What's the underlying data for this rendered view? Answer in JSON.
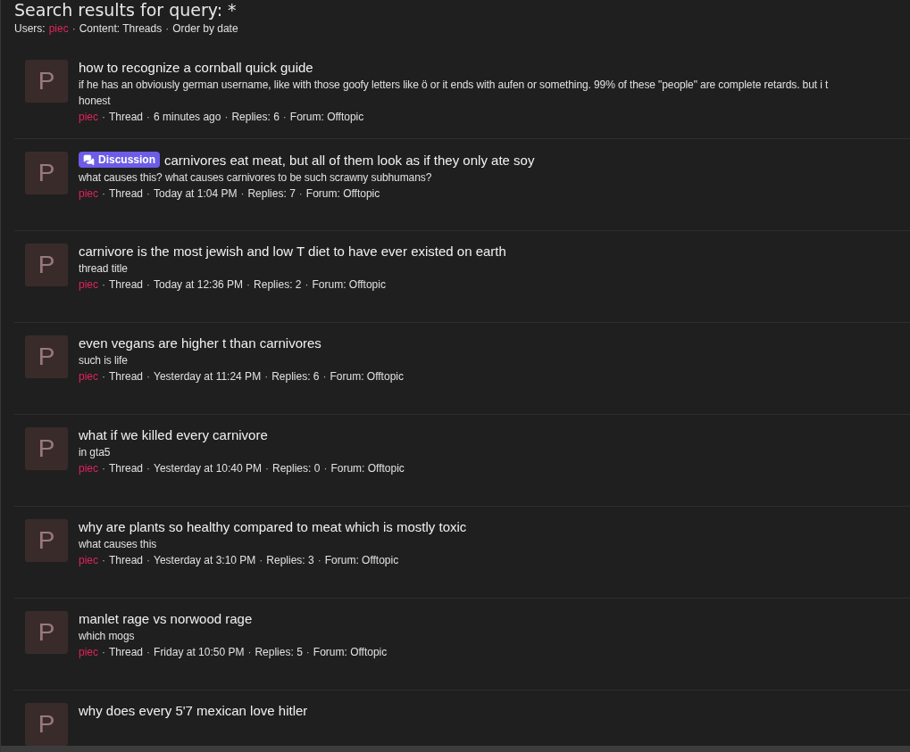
{
  "separator": "·",
  "header": {
    "title": "Search results for query: *",
    "filters": [
      {
        "label": "Users:",
        "value": "piec",
        "kind": "user"
      },
      {
        "label": "Content: Threads",
        "kind": "text"
      },
      {
        "label": "Order by date",
        "kind": "text"
      }
    ]
  },
  "results": [
    {
      "avatar": "P",
      "title": "how to recognize a cornball quick guide",
      "snippet_lines": [
        "if he has an obviously german username, like with those goofy letters like ö or it ends with aufen or something. 99% of these \"people\" are complete retards. but i t",
        "honest"
      ],
      "author": "piec",
      "meta": [
        "Thread",
        "6 minutes ago",
        "Replies: 6",
        "Forum: Offtopic"
      ]
    },
    {
      "avatar": "P",
      "prefix": {
        "label": "Discussion",
        "color": "#6c5ce7"
      },
      "title": "carnivores eat meat, but all of them look as if they only ate soy",
      "snippet_lines": [
        "what causes this? what causes carnivores to be such scrawny subhumans?"
      ],
      "author": "piec",
      "meta": [
        "Thread",
        "Today at 1:04 PM",
        "Replies: 7",
        "Forum: Offtopic"
      ]
    },
    {
      "avatar": "P",
      "title": "carnivore is the most jewish and low T diet to have ever existed on earth",
      "snippet_lines": [
        "thread title"
      ],
      "author": "piec",
      "meta": [
        "Thread",
        "Today at 12:36 PM",
        "Replies: 2",
        "Forum: Offtopic"
      ]
    },
    {
      "avatar": "P",
      "title": "even vegans are higher t than carnivores",
      "snippet_lines": [
        "such is life"
      ],
      "author": "piec",
      "meta": [
        "Thread",
        "Yesterday at 11:24 PM",
        "Replies: 6",
        "Forum: Offtopic"
      ]
    },
    {
      "avatar": "P",
      "title": "what if we killed every carnivore",
      "snippet_lines": [
        "in gta5"
      ],
      "author": "piec",
      "meta": [
        "Thread",
        "Yesterday at 10:40 PM",
        "Replies: 0",
        "Forum: Offtopic"
      ]
    },
    {
      "avatar": "P",
      "title": "why are plants so healthy compared to meat which is mostly toxic",
      "snippet_lines": [
        "what causes this"
      ],
      "author": "piec",
      "meta": [
        "Thread",
        "Yesterday at 3:10 PM",
        "Replies: 3",
        "Forum: Offtopic"
      ]
    },
    {
      "avatar": "P",
      "title": "manlet rage vs norwood rage",
      "snippet_lines": [
        "which mogs"
      ],
      "author": "piec",
      "meta": [
        "Thread",
        "Friday at 10:50 PM",
        "Replies: 5",
        "Forum: Offtopic"
      ]
    },
    {
      "avatar": "P",
      "title": "why does every 5'7 mexican love hitler"
    }
  ]
}
